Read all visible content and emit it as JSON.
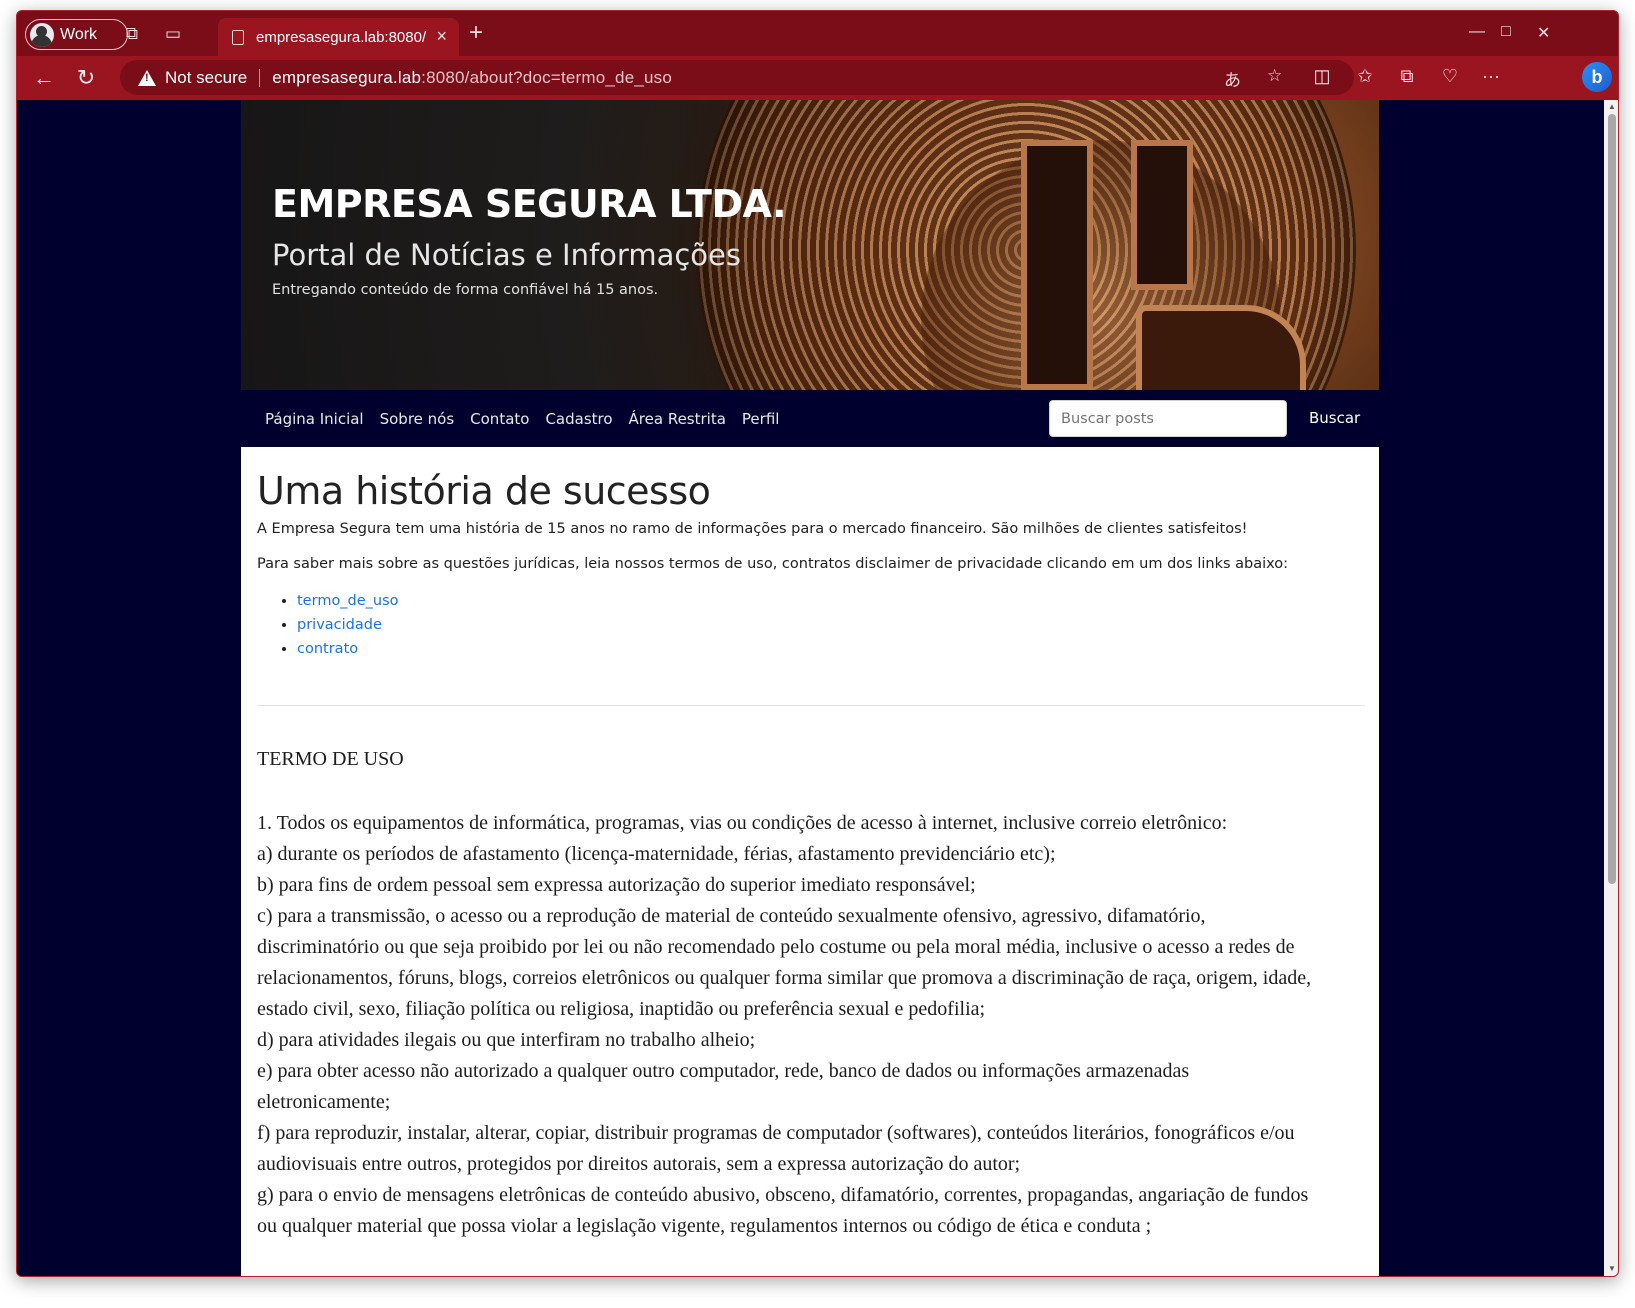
{
  "browser": {
    "profile_label": "Work",
    "tab_title": "empresasegura.lab:8080/",
    "security_label": "Not secure",
    "url_host": "empresasegura.lab",
    "url_rest": ":8080/about?doc=termo_de_uso",
    "accent": "#9b1520"
  },
  "site": {
    "title": "EMPRESA SEGURA LTDA.",
    "subtitle": "Portal de Notícias e Informações",
    "tagline": "Entregando conteúdo de forma confiável há 15 anos."
  },
  "nav": {
    "items": [
      {
        "label": "Página Inicial"
      },
      {
        "label": "Sobre nós"
      },
      {
        "label": "Contato"
      },
      {
        "label": "Cadastro"
      },
      {
        "label": "Área Restrita"
      },
      {
        "label": "Perfil"
      }
    ],
    "search_placeholder": "Buscar posts",
    "search_button": "Buscar"
  },
  "main": {
    "heading": "Uma história de sucesso",
    "intro": "A Empresa Segura tem uma história de 15 anos no ramo de informações para o mercado financeiro. São milhões de clientes satisfeitos!",
    "links_intro": "Para saber mais sobre as questões jurídicas, leia nossos termos de uso, contratos disclaimer de privacidade clicando em um dos links abaixo:",
    "doc_links": [
      {
        "label": "termo_de_uso"
      },
      {
        "label": "privacidade"
      },
      {
        "label": "contrato"
      }
    ]
  },
  "document": {
    "title": "TERMO DE USO",
    "lines": [
      "1. Todos os equipamentos de informática, programas, vias ou condições de acesso à internet, inclusive correio eletrônico:",
      "a) durante os períodos de afastamento (licença-maternidade, férias, afastamento previdenciário etc);",
      "b) para fins de ordem pessoal sem expressa autorização do superior imediato responsável;",
      "c) para a transmissão, o acesso ou a reprodução de material de conteúdo sexualmente ofensivo, agressivo, difamatório, discriminatório ou que seja proibido por lei ou não recomendado pelo costume ou pela moral média, inclusive o acesso a redes de relacionamentos, fóruns, blogs, correios eletrônicos ou qualquer forma similar que promova a discriminação de raça, origem, idade, estado civil, sexo, filiação política ou religiosa, inaptidão ou preferência sexual e pedofilia;",
      "d) para atividades ilegais ou que interfiram no trabalho alheio;",
      "e) para obter acesso não autorizado a qualquer outro computador, rede, banco de dados ou informações armazenadas eletronicamente;",
      "f) para reproduzir, instalar, alterar, copiar, distribuir programas de computador (softwares), conteúdos literários, fonográficos e/ou audiovisuais entre outros, protegidos por direitos autorais, sem a expressa autorização do autor;",
      "g) para o envio de mensagens eletrônicas de conteúdo abusivo, obsceno, difamatório, correntes, propagandas, angariação de fundos ou qualquer material que possa violar a legislação vigente, regulamentos internos ou código de ética e conduta ;"
    ]
  }
}
